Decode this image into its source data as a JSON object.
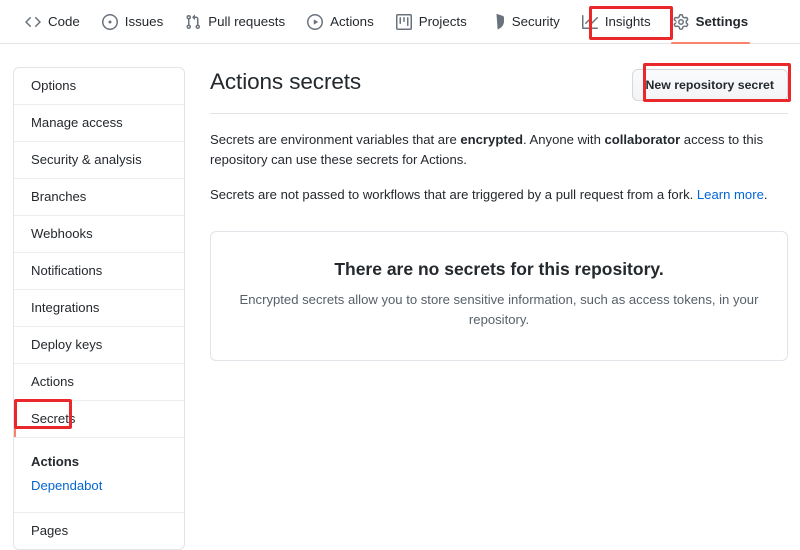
{
  "repo_nav": {
    "items": [
      {
        "label": "Code",
        "icon": "code-icon",
        "active": false
      },
      {
        "label": "Issues",
        "icon": "issue-opened-icon",
        "active": false
      },
      {
        "label": "Pull requests",
        "icon": "git-pull-request-icon",
        "active": false
      },
      {
        "label": "Actions",
        "icon": "play-icon",
        "active": false
      },
      {
        "label": "Projects",
        "icon": "project-icon",
        "active": false
      },
      {
        "label": "Security",
        "icon": "shield-icon",
        "active": false
      },
      {
        "label": "Insights",
        "icon": "graph-icon",
        "active": false
      },
      {
        "label": "Settings",
        "icon": "gear-icon",
        "active": true
      }
    ]
  },
  "sidebar": {
    "items": [
      {
        "label": "Options"
      },
      {
        "label": "Manage access"
      },
      {
        "label": "Security & analysis"
      },
      {
        "label": "Branches"
      },
      {
        "label": "Webhooks"
      },
      {
        "label": "Notifications"
      },
      {
        "label": "Integrations"
      },
      {
        "label": "Deploy keys"
      },
      {
        "label": "Actions"
      },
      {
        "label": "Secrets"
      }
    ],
    "secrets_submenu": [
      {
        "label": "Actions",
        "current": true
      },
      {
        "label": "Dependabot",
        "current": false
      }
    ],
    "trailing_items": [
      {
        "label": "Pages"
      }
    ]
  },
  "main": {
    "title": "Actions secrets",
    "new_secret_button": "New repository secret",
    "description_1": {
      "part_1": "Secrets are environment variables that are ",
      "bold_1": "encrypted",
      "part_2": ". Anyone with ",
      "bold_2": "collaborator",
      "part_3": " access to this repository can use these secrets for Actions."
    },
    "description_2": {
      "text": "Secrets are not passed to workflows that are triggered by a pull request from a fork. ",
      "link": "Learn more",
      "suffix": "."
    },
    "empty_state": {
      "title": "There are no secrets for this repository.",
      "subtitle": "Encrypted secrets allow you to store sensitive information, such as access tokens, in your repository."
    }
  },
  "annotations": {
    "highlight_color": "#e8282a",
    "boxes": [
      {
        "name": "settings-tab-highlight"
      },
      {
        "name": "new-repository-secret-highlight"
      },
      {
        "name": "secrets-sidebar-highlight"
      }
    ]
  },
  "colors": {
    "link": "#0366d6",
    "accent_selected": "#f9826c",
    "border": "#e1e4e8",
    "text": "#24292e",
    "muted_text": "#586069"
  }
}
